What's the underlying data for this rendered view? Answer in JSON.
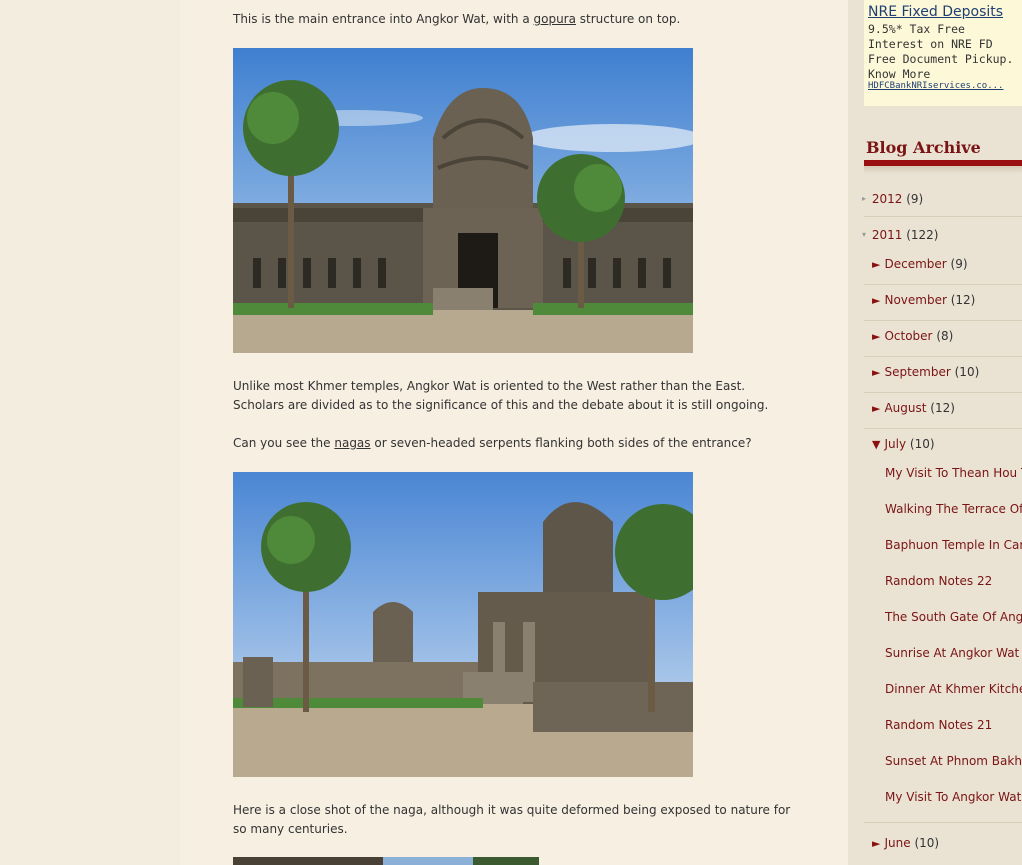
{
  "post": {
    "para1_before": "This is the main entrance into Angkor Wat, with a ",
    "para1_link": "gopura",
    "para1_after": " structure on top.",
    "para2": "Unlike most Khmer temples, Angkor Wat is oriented to the West rather than the East. Scholars are divided as to the significance of this and the debate about it is still ongoing.",
    "para3_before": "Can you see the ",
    "para3_link": "nagas",
    "para3_after": " or seven-headed serpents flanking both sides of the entrance?",
    "para4": "Here is a close shot of the naga, although it was quite deformed being exposed to nature for so many centuries."
  },
  "ad": {
    "title": "NRE Fixed Deposits",
    "body": "9.5%* Tax Free\nInterest on NRE FD\nFree Document Pickup.\nKnow More",
    "url": "HDFCBankNRIservices.co..."
  },
  "archive": {
    "heading": "Blog Archive",
    "years": [
      {
        "label": "2012",
        "count": "(9)",
        "toggle": "▸"
      },
      {
        "label": "2011",
        "count": "(122)",
        "toggle": "▾"
      }
    ],
    "months": [
      {
        "label": "December",
        "count": "(9)",
        "toggle": "►"
      },
      {
        "label": "November",
        "count": "(12)",
        "toggle": "►"
      },
      {
        "label": "October",
        "count": "(8)",
        "toggle": "►"
      },
      {
        "label": "September",
        "count": "(10)",
        "toggle": "►"
      },
      {
        "label": "August",
        "count": "(12)",
        "toggle": "►"
      },
      {
        "label": "July",
        "count": "(10)",
        "toggle": "▼"
      }
    ],
    "july_posts": [
      "My Visit To Thean Hou Temple",
      "Walking The Terrace Of The Elephants",
      "Baphuon Temple In Cambodia",
      "Random Notes 22",
      "The South Gate Of Angkor Thom",
      "Sunrise At Angkor Wat",
      "Dinner At Khmer Kitchen",
      "Random Notes 21",
      "Sunset At Phnom Bakheng",
      "My Visit To Angkor Wat"
    ],
    "last_month": {
      "label": "June",
      "count": "(10)",
      "toggle": "►"
    }
  },
  "colors": {
    "page_bg": "#f3ede0",
    "sidebar_bg": "#eae3d4",
    "accent": "#7a1414",
    "rule": "#9a1010"
  }
}
